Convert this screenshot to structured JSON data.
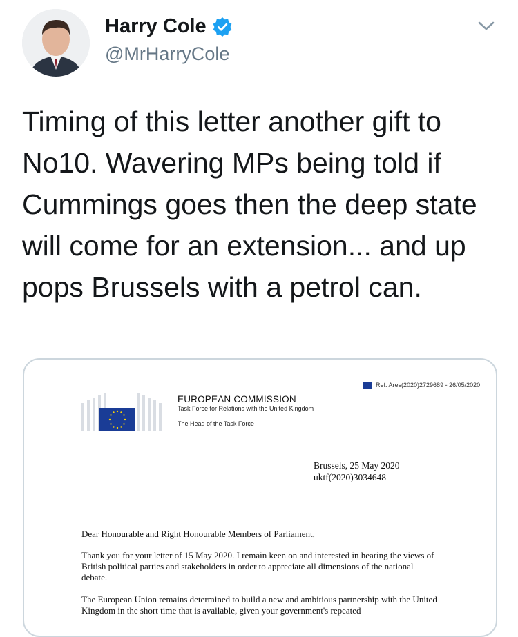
{
  "author": {
    "name": "Harry Cole",
    "handle": "@MrHarryCole"
  },
  "tweet": {
    "text": "Timing of this letter another gift to No10. Wavering MPs being told if Cummings goes then the deep state will come for an extension... and up pops Brussels with a petrol can."
  },
  "letter": {
    "ref": "Ref. Ares(2020)2729689 - 26/05/2020",
    "org": "EUROPEAN COMMISSION",
    "task_force": "Task Force for Relations with the United Kingdom",
    "head": "The Head of the Task Force",
    "place_date": "Brussels, 25 May 2020",
    "doc_ref": "uktf(2020)3034648",
    "salutation": "Dear Honourable and Right Honourable Members of Parliament,",
    "para1": "Thank you for your letter of 15 May 2020. I remain keen on and interested in hearing the views of British political parties and stakeholders in order to appreciate all dimensions of the national debate.",
    "para2": "The European Union remains determined to build a new and ambitious partnership with the United Kingdom in the short time that is available, given your government's repeated"
  },
  "colors": {
    "verified": "#1da1f2",
    "handle": "#657786",
    "eu_blue": "#1a3c96"
  },
  "icons": {
    "verified": "verified-badge-icon",
    "more": "chevron-down-icon",
    "eu": "eu-flag-icon"
  }
}
